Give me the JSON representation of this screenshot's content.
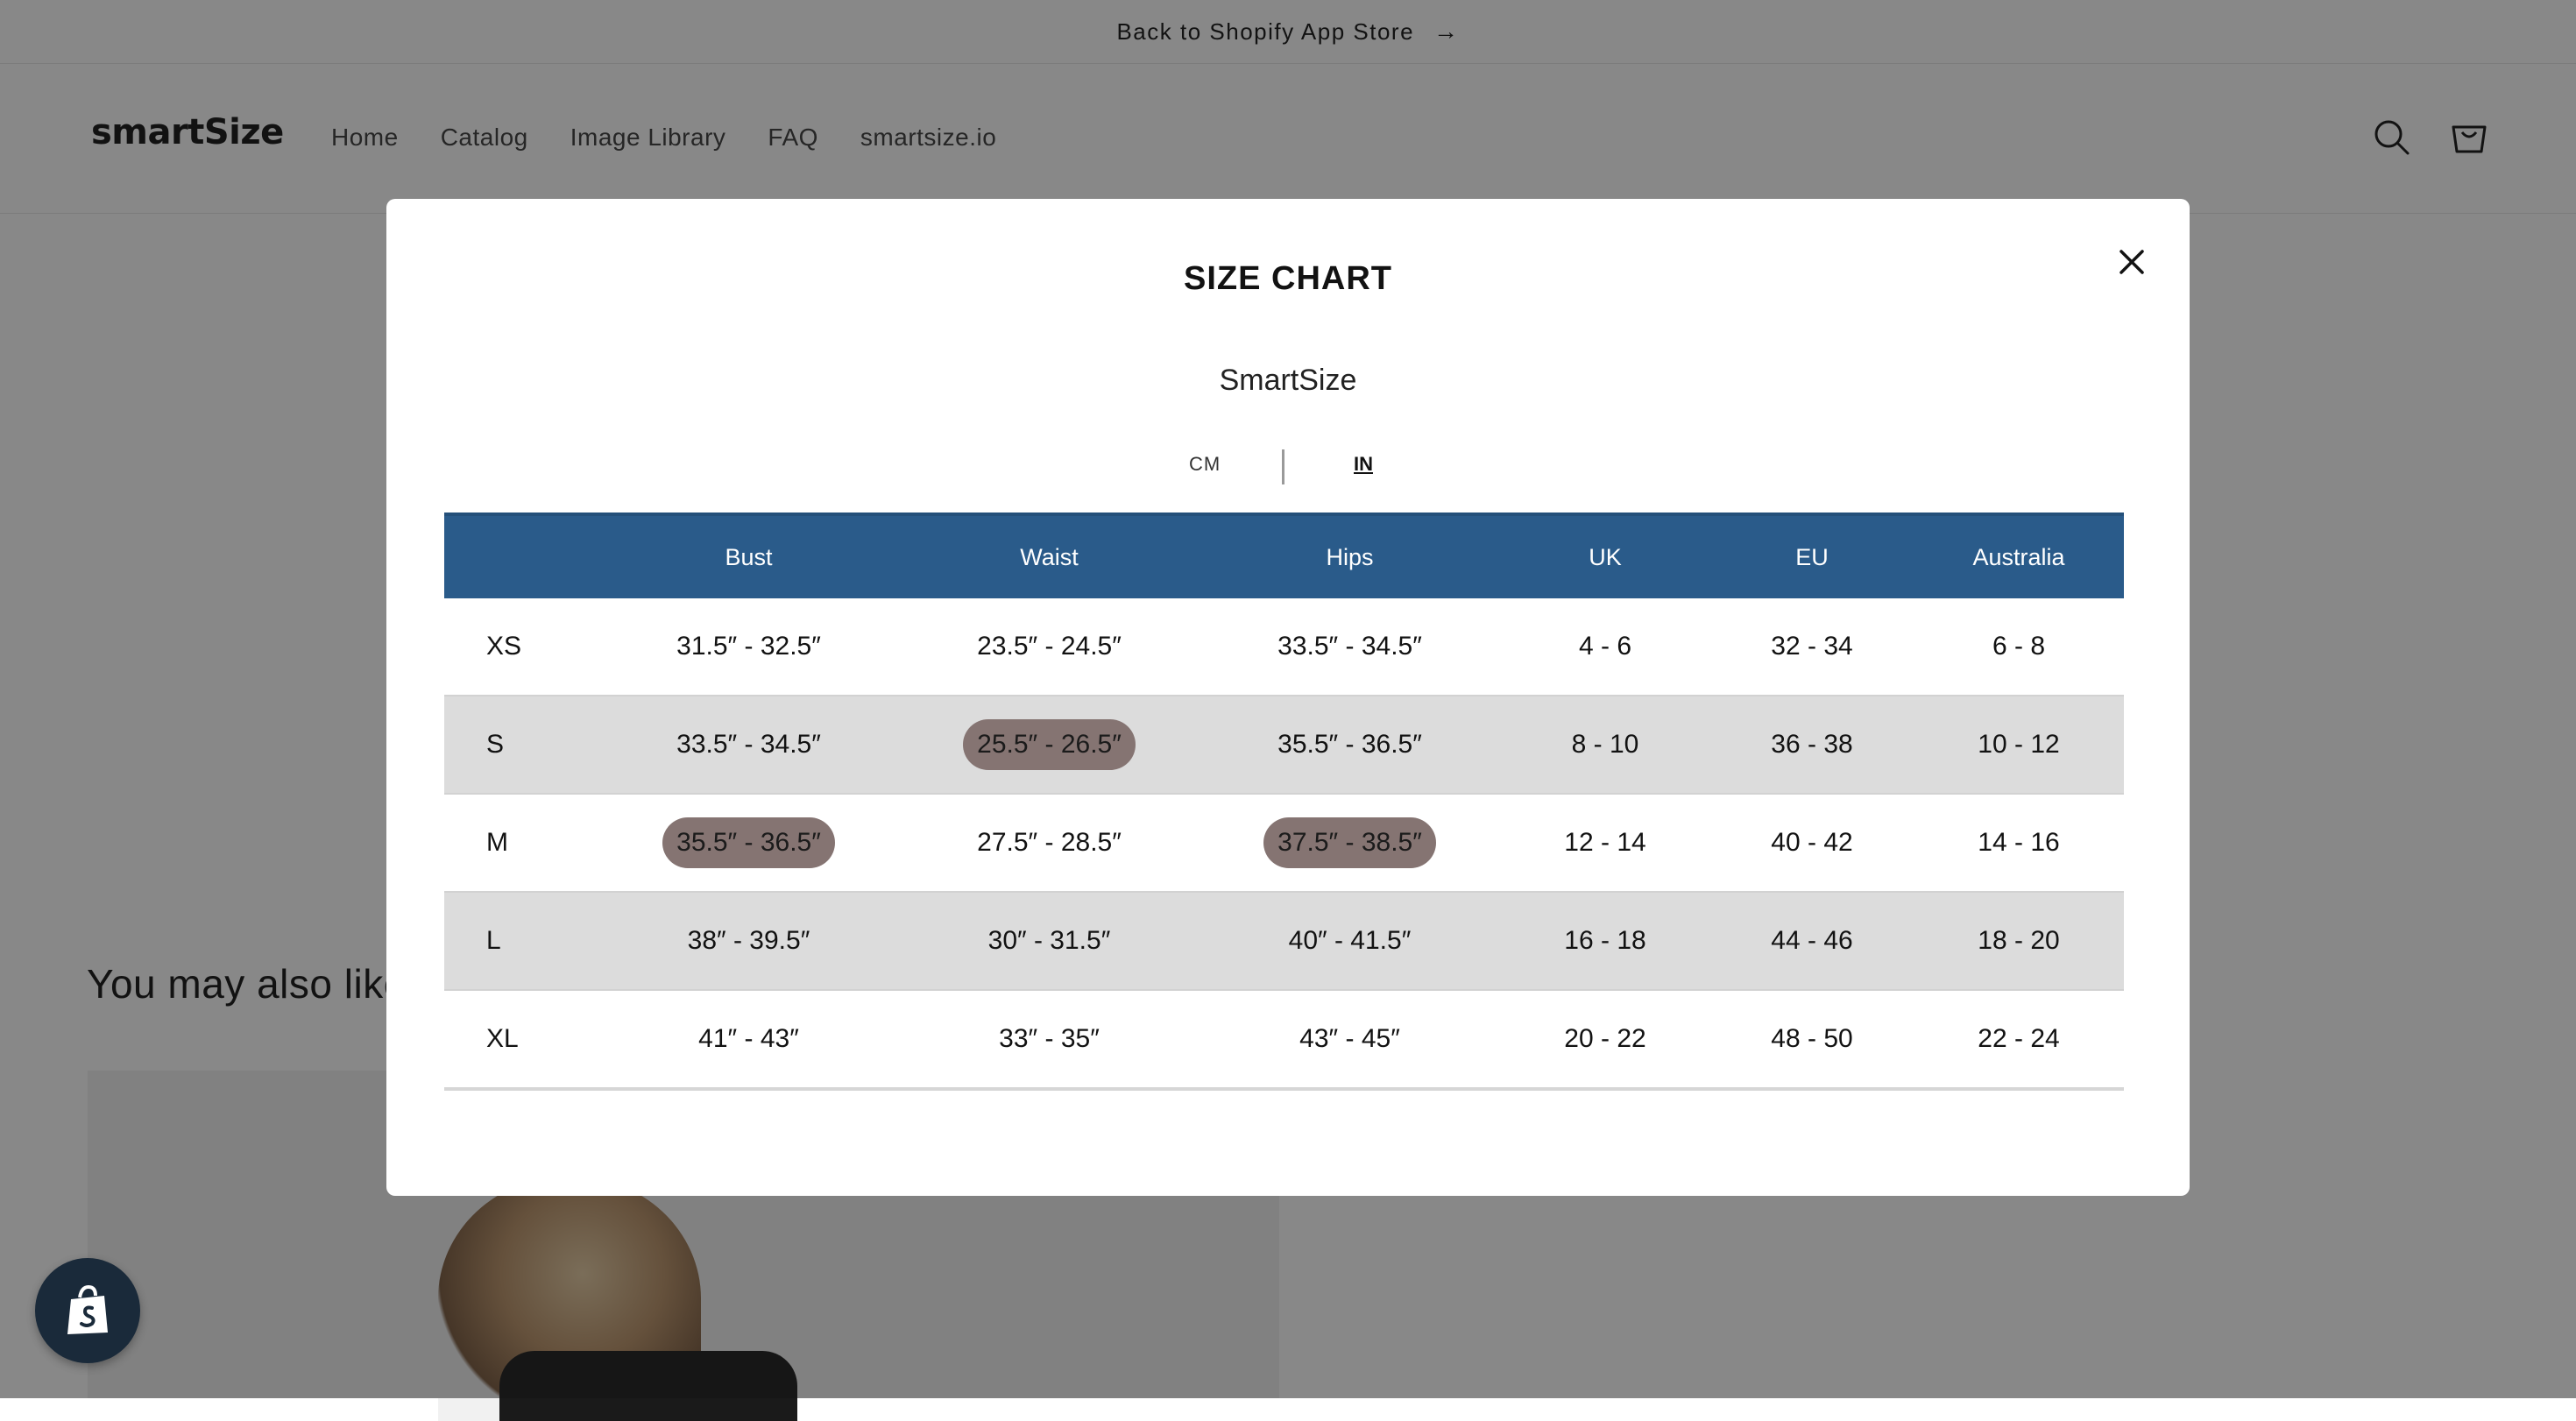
{
  "announcement": {
    "text": "Back to Shopify App Store",
    "arrow": "→"
  },
  "header": {
    "logo": "smartSize",
    "nav": [
      "Home",
      "Catalog",
      "Image Library",
      "FAQ",
      "smartsize.io"
    ],
    "icons": [
      "search-icon",
      "cart-icon"
    ]
  },
  "page": {
    "also_like": "You may also like"
  },
  "modal": {
    "title": "SIZE CHART",
    "brand": "SmartSize",
    "units": {
      "cm": "CM",
      "in": "IN",
      "selected": "IN"
    },
    "table": {
      "headers": [
        "",
        "Bust",
        "Waist",
        "Hips",
        "UK",
        "EU",
        "Australia"
      ],
      "rows": [
        {
          "size": "XS",
          "bust": "31.5″ - 32.5″",
          "waist": "23.5″ - 24.5″",
          "hips": "33.5″ - 34.5″",
          "uk": "4 - 6",
          "eu": "32 - 34",
          "au": "6 - 8"
        },
        {
          "size": "S",
          "bust": "33.5″ - 34.5″",
          "waist": "25.5″ - 26.5″",
          "hips": "35.5″ - 36.5″",
          "uk": "8 - 10",
          "eu": "36 - 38",
          "au": "10 - 12"
        },
        {
          "size": "M",
          "bust": "35.5″ - 36.5″",
          "waist": "27.5″ - 28.5″",
          "hips": "37.5″ - 38.5″",
          "uk": "12 - 14",
          "eu": "40 - 42",
          "au": "14 - 16"
        },
        {
          "size": "L",
          "bust": "38″ - 39.5″",
          "waist": "30″ - 31.5″",
          "hips": "40″ - 41.5″",
          "uk": "16 - 18",
          "eu": "44 - 46",
          "au": "18 - 20"
        },
        {
          "size": "XL",
          "bust": "41″ - 43″",
          "waist": "33″ - 35″",
          "hips": "43″ - 45″",
          "uk": "20 - 22",
          "eu": "48 - 50",
          "au": "22 - 24"
        }
      ],
      "highlighted": [
        "S.waist",
        "M.bust",
        "M.hips"
      ]
    }
  },
  "colors": {
    "header_bg": "#2a5b8a",
    "alt_row": "#dcdcdc",
    "highlight": "#857472",
    "overlay": "rgba(18,18,18,0.5)"
  }
}
